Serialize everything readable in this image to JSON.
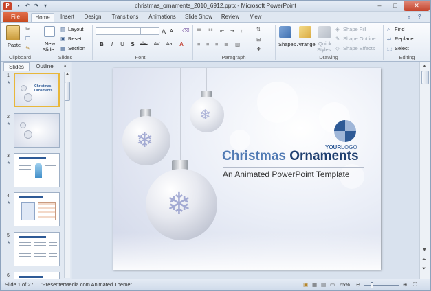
{
  "window": {
    "title": "christmas_ornaments_2010_6912.pptx  -  Microsoft PowerPoint",
    "app_icon_letter": "P",
    "controls": [
      "–",
      "□",
      "✕"
    ]
  },
  "quick_access": [
    "save-icon",
    "undo-icon",
    "redo-icon",
    "customize-icon"
  ],
  "tabs": {
    "file": "File",
    "items": [
      "Home",
      "Insert",
      "Design",
      "Transitions",
      "Animations",
      "Slide Show",
      "Review",
      "View"
    ],
    "active": "Home"
  },
  "ribbon": {
    "clipboard": {
      "paste": "Paste",
      "label": "Clipboard"
    },
    "slides": {
      "new_slide_line1": "New",
      "new_slide_line2": "Slide",
      "layout": "Layout",
      "reset": "Reset",
      "section": "Section",
      "label": "Slides"
    },
    "font": {
      "label": "Font",
      "bold": "B",
      "italic": "I",
      "underline": "U",
      "strike": "S",
      "abc": "abc",
      "av": "AV",
      "aa": "Aa",
      "grow": "A",
      "shrink": "A",
      "color": "A"
    },
    "paragraph": {
      "label": "Paragraph"
    },
    "drawing": {
      "shapes": "Shapes",
      "arrange": "Arrange",
      "quick_styles_line1": "Quick",
      "quick_styles_line2": "Styles",
      "shape_fill": "Shape Fill",
      "shape_outline": "Shape Outline",
      "shape_effects": "Shape Effects",
      "label": "Drawing"
    },
    "editing": {
      "find": "Find",
      "replace": "Replace",
      "select": "Select",
      "label": "Editing"
    }
  },
  "left_pane": {
    "tabs": [
      "Slides",
      "Outline"
    ],
    "active_tab": "Slides",
    "close": "×",
    "thumbnails": [
      {
        "number": "1",
        "title": "Christmas Ornaments"
      },
      {
        "number": "2",
        "title": ""
      },
      {
        "number": "3",
        "title": ""
      },
      {
        "number": "4",
        "title": ""
      },
      {
        "number": "5",
        "title": ""
      },
      {
        "number": "6",
        "title": ""
      }
    ]
  },
  "slide": {
    "title_part1": "Christmas",
    "title_part2": "Ornaments",
    "subtitle": "An Animated PowerPoint Template",
    "logo_text_1": "YOUR",
    "logo_text_2": "LOGO"
  },
  "status": {
    "slide_info": "Slide 1 of 27",
    "theme": "\"PresenterMedia.com Animated Theme\"",
    "zoom": "65%"
  },
  "colors": {
    "accent": "#2e5a96",
    "file_tab": "#c6481e",
    "title_blue": "#2e5a96",
    "selection": "#e8b73b"
  }
}
